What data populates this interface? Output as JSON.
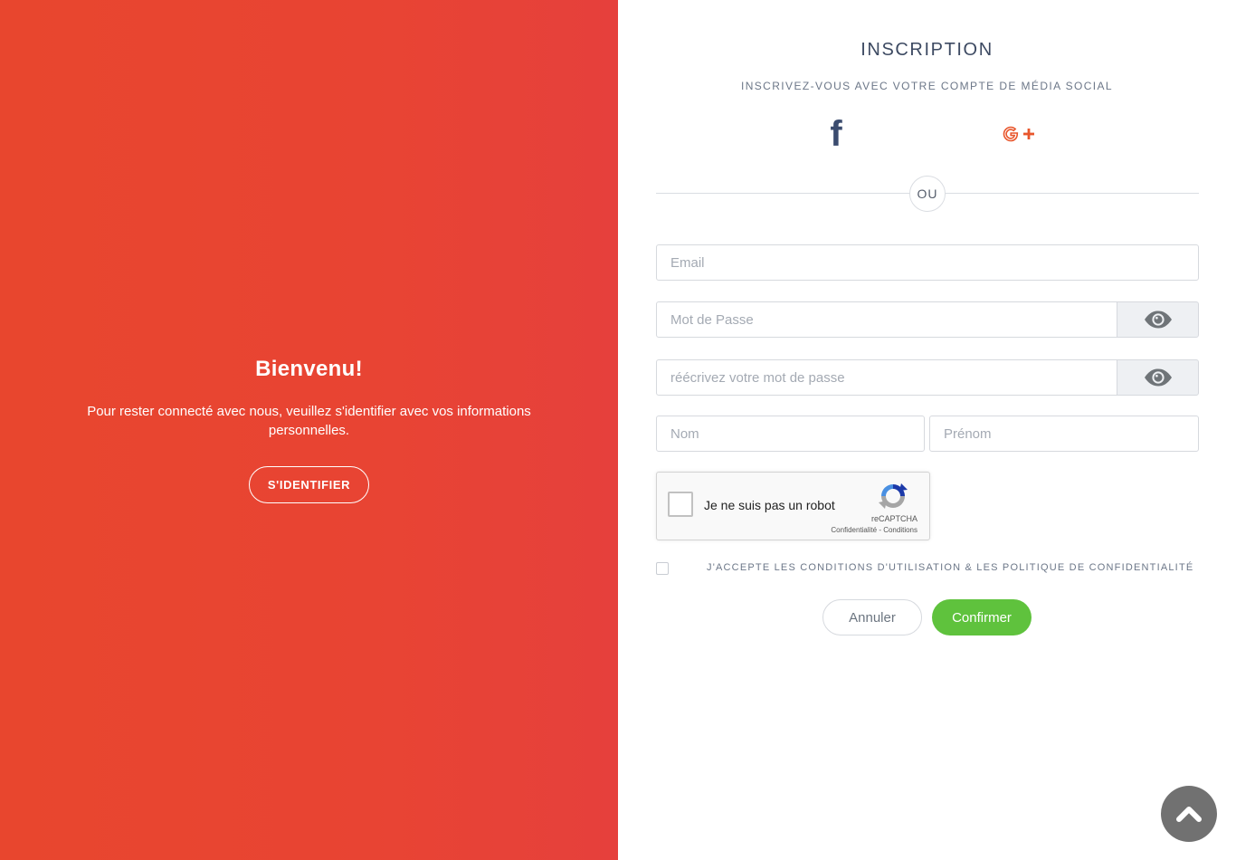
{
  "welcome": {
    "title": "Bienvenu!",
    "text": "Pour rester connecté avec nous, veuillez s'identifier avec vos informations personnelles.",
    "signin_label": "S'IDENTIFIER"
  },
  "form": {
    "title": "INSCRIPTION",
    "social_subtitle": "INSCRIVEZ-VOUS AVEC VOTRE COMPTE DE MÉDIA SOCIAL",
    "facebook_glyph": "f",
    "separator": "OU",
    "email_placeholder": "Email",
    "password_placeholder": "Mot de Passe",
    "password_confirm_placeholder": "réécrivez votre mot de passe",
    "nom_placeholder": "Nom",
    "prenom_placeholder": "Prénom",
    "recaptcha": {
      "label": "Je ne suis pas un robot",
      "brand": "reCAPTCHA",
      "links": "Confidentialité - Conditions"
    },
    "terms_label": "J'ACCEPTE LES CONDITIONS D'UTILISATION & LES POLITIQUE DE CONFIDENTIALITÉ",
    "cancel_label": "Annuler",
    "confirm_label": "Confirmer"
  },
  "colors": {
    "left_panel": "#e8462e",
    "confirm_button": "#5fc23d",
    "google_plus": "#e8562c",
    "facebook": "#3b4c6f"
  },
  "icons": {
    "facebook": "facebook-icon",
    "google_plus": "google-plus-icon",
    "eye": "eye-icon",
    "scroll_top": "chevron-up-icon"
  }
}
